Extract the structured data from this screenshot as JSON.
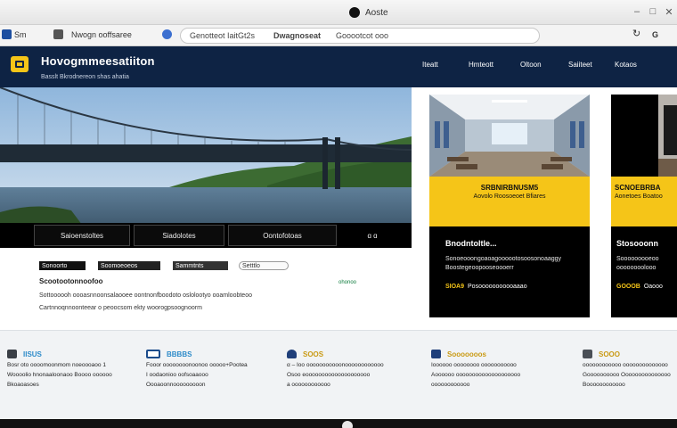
{
  "os": {
    "title": "Aoste",
    "controls": {
      "minimize": "–",
      "maximize": "□",
      "close": "✕"
    }
  },
  "browser": {
    "left_items": [
      "Sm",
      "Nwogn ooffsaree"
    ],
    "address_segments": [
      "Genotteot Iait",
      "Gt2s",
      "Dwagnoseat",
      "Gooootcot ooo"
    ],
    "toolbar_right": [
      "↻",
      "G"
    ]
  },
  "site": {
    "name": "Hovogmmeesatiiton",
    "subtitle": "Basslt   Bkrodnereon shas ahatia",
    "nav": [
      "Iteatt",
      "Hmteott",
      "Oltoon",
      "Saiiteet",
      "Kotaos"
    ]
  },
  "hero": {
    "buttons": [
      "Saioenstoltes",
      "Siadolotes",
      "Oontofotoas"
    ],
    "pager": "ɑ ɑ"
  },
  "intro": {
    "tags": [
      "Sonoorto",
      "Soomoeoeos",
      "Sammtnts",
      "Setttlo"
    ],
    "headline": "Scootootonnoofoo",
    "link": "ohonoo",
    "lines": [
      "Sottoooooh oooasnnoonsalaooee oontnonfboodoto oslolootyo ooamloobteoo",
      "Cartnnoqnnoonteear o peoocsom ekty woorogpsoognoorm"
    ]
  },
  "cards": [
    {
      "yellow_title": "SRBNIRBNUSM5",
      "yellow_sub": "Aovolo Roosoeoet Bfiares",
      "dark_title": "Bnodntoltle...",
      "dark_text": "Sonoeooongoaoagoooootosoosonoaaggy Boostegeoopooseoooerr",
      "footer_highlight": "SIOA9",
      "footer_text": "Posooooooooooaaao"
    },
    {
      "yellow_title": "SCNOEBRBA",
      "yellow_sub": "Aonetoes Boatoo",
      "dark_title": "Stosooonn",
      "dark_text": "Sooooooooeoo oooooooolooo",
      "footer_highlight": "GOOOB",
      "footer_text": "Oaooo"
    }
  ],
  "features": [
    {
      "icon": "document-icon",
      "color": "#2e8bc9",
      "title": "IISUS",
      "lines": [
        "Bosr oto oooomoonmom noeoooaoo 1",
        "Woooolio hnonaaloonaoo Boooo oooooo",
        "Bkoaoasoes"
      ]
    },
    {
      "icon": "card-icon",
      "color": "#2e8bc9",
      "title": "BBBBS",
      "lines": [
        "Fooor oooooooonoonoo ooooo+Pootea",
        "I oodaonioo oofsoaaooo",
        "Oooaoonnooooooooon"
      ]
    },
    {
      "icon": "shield-icon",
      "color": "#c99a14",
      "title": "SOOS",
      "lines": [
        "α – Ioo ooooooooooonoooooooooooo",
        "Osoo eoooooooooooooooooooo",
        "a oooooooooooo"
      ]
    },
    {
      "icon": "globe-icon",
      "color": "#c99a14",
      "title": "Sooooooos",
      "lines": [
        "Ioooooo oooooooo ooooooooooo",
        "Aoooooo oooooooooooooooooooo",
        "oooooooooooo"
      ]
    },
    {
      "icon": "chart-icon",
      "color": "#c99a14",
      "title": "SOOO",
      "lines": [
        "oooooooooooo oooooooooooooo",
        "Goooooooooo Ooooooooooooooo",
        "Boooooooooooo"
      ]
    }
  ]
}
